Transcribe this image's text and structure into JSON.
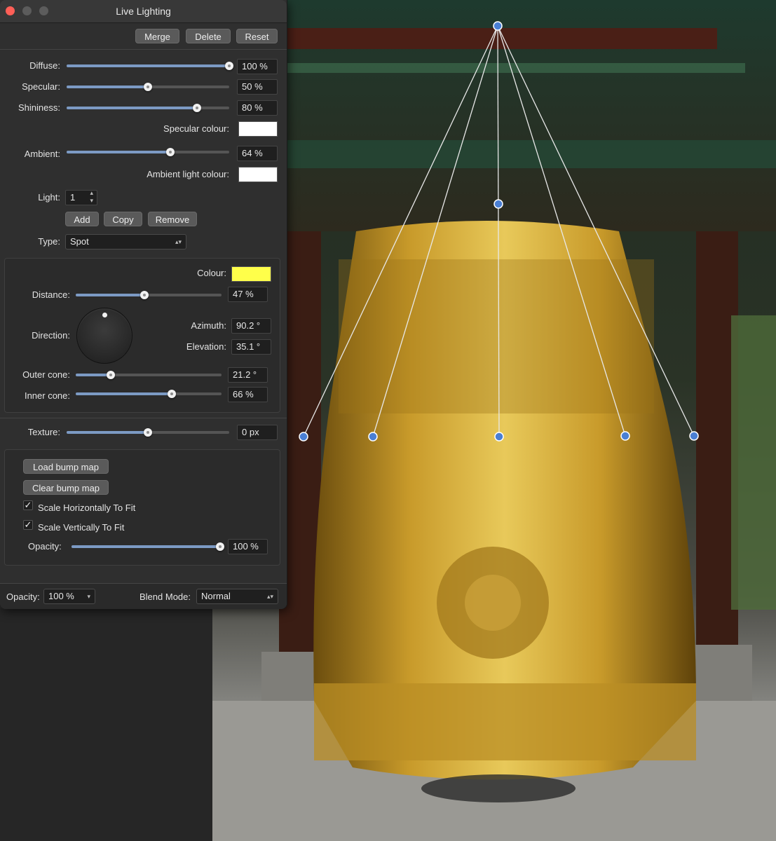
{
  "window": {
    "title": "Live Lighting"
  },
  "toolbar": {
    "merge": "Merge",
    "delete": "Delete",
    "reset": "Reset"
  },
  "material": {
    "diffuse": {
      "label": "Diffuse:",
      "value": "100 %",
      "level": 1.0
    },
    "specular": {
      "label": "Specular:",
      "value": "50 %",
      "level": 0.5
    },
    "shininess": {
      "label": "Shininess:",
      "value": "80 %",
      "level": 0.8
    },
    "specular_colour": {
      "label": "Specular colour:",
      "color": "#ffffff"
    },
    "ambient": {
      "label": "Ambient:",
      "value": "64 %",
      "level": 0.64
    },
    "ambient_light_colour": {
      "label": "Ambient light colour:",
      "color": "#ffffff"
    }
  },
  "light_select": {
    "label": "Light:",
    "value": "1",
    "stepper_up": "▴",
    "stepper_down": "▾"
  },
  "light_buttons": {
    "add": "Add",
    "copy": "Copy",
    "remove": "Remove"
  },
  "type": {
    "label": "Type:",
    "value": "Spot",
    "arrows": "▴▾"
  },
  "light": {
    "colour": {
      "label": "Colour:",
      "color": "#ffff4a"
    },
    "distance": {
      "label": "Distance:",
      "value": "47 %",
      "level": 0.47
    },
    "direction": {
      "label": "Direction:"
    },
    "azimuth": {
      "label": "Azimuth:",
      "value": "90.2 °"
    },
    "elevation": {
      "label": "Elevation:",
      "value": "35.1 °"
    },
    "outer_cone": {
      "label": "Outer cone:",
      "value": "21.2 °",
      "level": 0.24
    },
    "inner_cone": {
      "label": "Inner cone:",
      "value": "66 %",
      "level": 0.66
    }
  },
  "texture": {
    "label": "Texture:",
    "value": "0 px",
    "level": 0.5
  },
  "bump": {
    "load": "Load bump map",
    "clear": "Clear bump map",
    "scale_h": {
      "label": "Scale Horizontally To Fit",
      "checked": true,
      "mark": "✓"
    },
    "scale_v": {
      "label": "Scale Vertically To Fit",
      "checked": true,
      "mark": "✓"
    },
    "opacity": {
      "label": "Opacity:",
      "value": "100 %",
      "level": 1.0
    }
  },
  "footer": {
    "opacity": {
      "label": "Opacity:",
      "value": "100 %",
      "arrow": "▾"
    },
    "blend_mode": {
      "label": "Blend Mode:",
      "value": "Normal",
      "arrows": "▴▾"
    }
  },
  "colors": {
    "close": "#ff5f57",
    "inactive": "#5c5c5c",
    "accent": "#7c9ac4",
    "handle": "#4a7fd4"
  }
}
